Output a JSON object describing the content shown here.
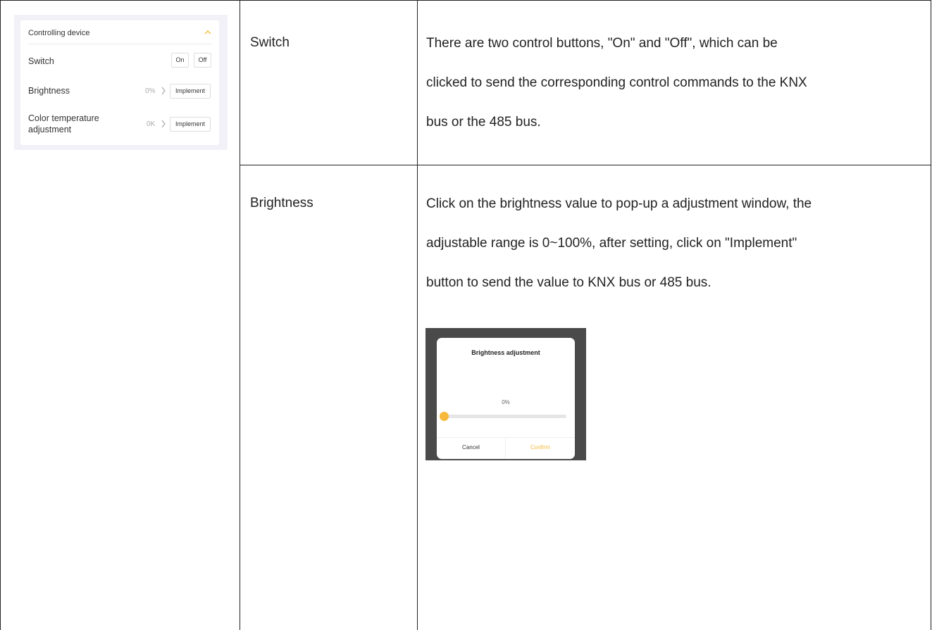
{
  "device_panel": {
    "title": "Controlling device",
    "switch_row": {
      "label": "Switch",
      "on_label": "On",
      "off_label": "Off"
    },
    "brightness_row": {
      "label": "Brightness",
      "value": "0%",
      "button_label": "Implement"
    },
    "color_temp_row": {
      "label_line1": "Color temperature",
      "label_line2": "adjustment",
      "value": "0K",
      "button_label": "Implement"
    },
    "accent_color": "#f6b93b"
  },
  "rows": [
    {
      "name": "Switch",
      "description_lines": [
        "There are two control buttons, \"On\" and \"Off\", which can be",
        "clicked to send the corresponding control commands to the KNX",
        "bus or the 485 bus."
      ]
    },
    {
      "name": "Brightness",
      "description_lines": [
        "Click on the brightness value to pop-up a adjustment window, the",
        "adjustable range is 0~100%, after setting, click on \"Implement\"",
        "button to send the value to KNX bus or 485 bus."
      ]
    }
  ],
  "brightness_popup": {
    "title": "Brightness adjustment",
    "value": "0%",
    "level": 0,
    "cancel_label": "Cancel",
    "confirm_label": "Confirm"
  }
}
